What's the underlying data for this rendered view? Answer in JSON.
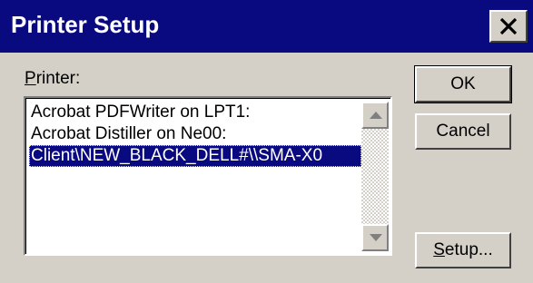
{
  "title": "Printer Setup",
  "printer_label": {
    "mnemonic": "P",
    "rest": "rinter:"
  },
  "printers": [
    {
      "name": "Acrobat PDFWriter on LPT1:",
      "selected": false
    },
    {
      "name": "Acrobat Distiller on Ne00:",
      "selected": false
    },
    {
      "name": "Client\\NEW_BLACK_DELL#\\\\SMA-X0",
      "selected": true
    }
  ],
  "buttons": {
    "ok": "OK",
    "cancel": "Cancel",
    "setup": {
      "mnemonic": "S",
      "rest": "etup..."
    }
  },
  "icons": {
    "close": "close-icon",
    "scroll_up": "arrow-up-icon",
    "scroll_down": "arrow-down-icon"
  },
  "colors": {
    "titlebar": "#0a0a80",
    "selection": "#0a0a80",
    "face": "#d4d0c8"
  }
}
